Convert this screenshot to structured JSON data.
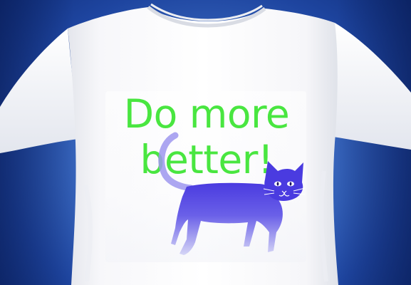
{
  "shirt": {
    "slogan_line1": "Do more",
    "slogan_line2": "better!",
    "slogan_color": "#49e640",
    "shirt_color": "#ffffff",
    "cat_color": "#4a3be0",
    "background_color": "#2a57b4"
  }
}
